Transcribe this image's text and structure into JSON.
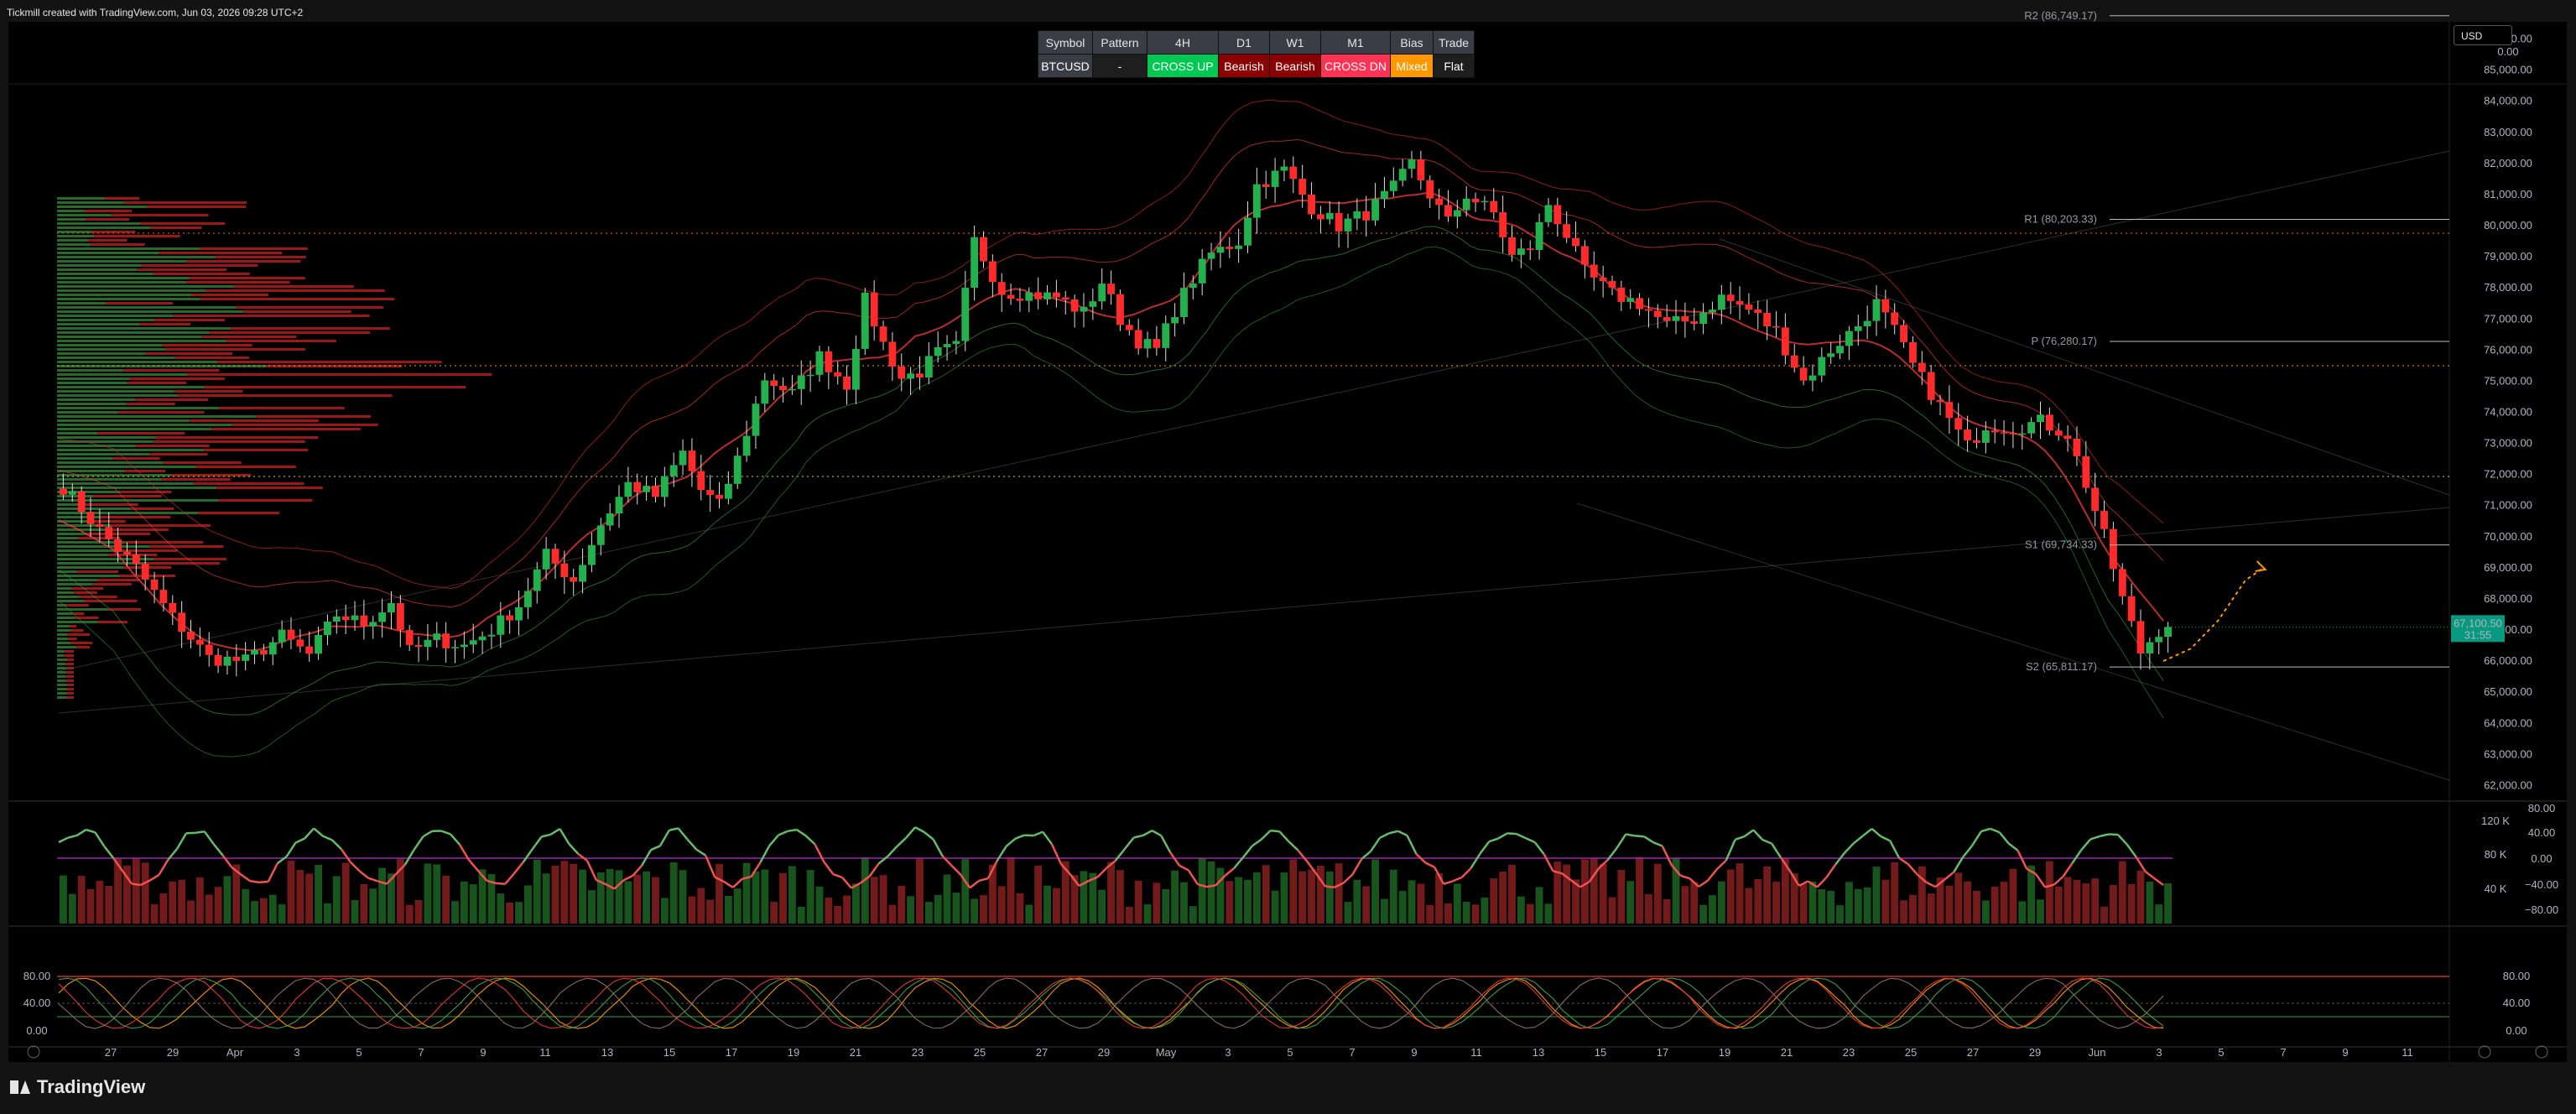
{
  "header": {
    "title": "Tickmill created with TradingView.com, Jun 03, 2026 09:28 UTC+2"
  },
  "currency_selector": {
    "value": "USD"
  },
  "brand": {
    "name": "TradingView"
  },
  "mtf_table": {
    "headers": [
      "Symbol",
      "Pattern",
      "4H",
      "D1",
      "W1",
      "M1",
      "Bias",
      "Trade"
    ],
    "values": [
      "BTCUSD",
      "-",
      "CROSS UP",
      "Bearish",
      "Bearish",
      "CROSS DN",
      "Mixed",
      "Flat"
    ],
    "value_colors": [
      "#3a3d45",
      "#1e1e1e",
      "#00c853",
      "#8b0000",
      "#8b0000",
      "#ff3355",
      "#ff9800",
      "#1e1e1e"
    ]
  },
  "chart_data": {
    "type": "candlestick",
    "symbol": "BTCUSD",
    "price_axis": {
      "ylim": [
        62000,
        86000
      ],
      "ticks": [
        "86,000.00",
        "85,000.00",
        "84,000.00",
        "83,000.00",
        "82,000.00",
        "81,000.00",
        "80,000.00",
        "79,000.00",
        "78,000.00",
        "77,000.00",
        "76,000.00",
        "75,000.00",
        "74,000.00",
        "73,000.00",
        "72,000.00",
        "71,000.00",
        "70,000.00",
        "69,000.00",
        "68,000.00",
        "67,000.00",
        "66,000.00",
        "65,000.00",
        "64,000.00",
        "63,000.00",
        "62,000.00"
      ],
      "top_label": "0.00"
    },
    "last_price": {
      "value": "67,100.50",
      "countdown": "31:55",
      "color": "#089981"
    },
    "pivots": [
      {
        "label": "R2 (86,749.17)",
        "value": 86749.17
      },
      {
        "label": "R1 (80,203.33)",
        "value": 80203.33
      },
      {
        "label": "P (76,280.17)",
        "value": 76280.17
      },
      {
        "label": "S1 (69,734.33)",
        "value": 69734.33
      },
      {
        "label": "S2 (65,811.17)",
        "value": 65811.17
      }
    ],
    "x_axis_ticks": [
      "27",
      "29",
      "Apr",
      "3",
      "5",
      "7",
      "9",
      "11",
      "13",
      "15",
      "17",
      "19",
      "21",
      "23",
      "25",
      "27",
      "29",
      "May",
      "3",
      "5",
      "7",
      "9",
      "11",
      "13",
      "15",
      "17",
      "19",
      "21",
      "23",
      "25",
      "27",
      "29",
      "Jun",
      "3",
      "5",
      "7",
      "9",
      "11"
    ],
    "close_path": [
      [
        0,
        71600
      ],
      [
        4,
        70200
      ],
      [
        8,
        69000
      ],
      [
        12,
        67400
      ],
      [
        16,
        66100
      ],
      [
        20,
        66000
      ],
      [
        24,
        66800
      ],
      [
        27,
        66200
      ],
      [
        30,
        67500
      ],
      [
        33,
        67200
      ],
      [
        36,
        67900
      ],
      [
        38,
        66300
      ],
      [
        41,
        66700
      ],
      [
        44,
        66500
      ],
      [
        47,
        67000
      ],
      [
        50,
        67800
      ],
      [
        53,
        69400
      ],
      [
        56,
        68600
      ],
      [
        59,
        70400
      ],
      [
        62,
        71700
      ],
      [
        65,
        71300
      ],
      [
        68,
        72700
      ],
      [
        70,
        71500
      ],
      [
        72,
        71000
      ],
      [
        74,
        72500
      ],
      [
        77,
        75100
      ],
      [
        80,
        74600
      ],
      [
        83,
        75800
      ],
      [
        86,
        74900
      ],
      [
        88,
        77600
      ],
      [
        90,
        76200
      ],
      [
        92,
        75100
      ],
      [
        94,
        75300
      ],
      [
        96,
        75900
      ],
      [
        98,
        76100
      ],
      [
        100,
        79500
      ],
      [
        103,
        77900
      ],
      [
        106,
        77800
      ],
      [
        109,
        77700
      ],
      [
        112,
        77200
      ],
      [
        114,
        78200
      ],
      [
        116,
        77000
      ],
      [
        118,
        76300
      ],
      [
        120,
        76000
      ],
      [
        122,
        77300
      ],
      [
        124,
        78300
      ],
      [
        126,
        79100
      ],
      [
        129,
        79500
      ],
      [
        131,
        81300
      ],
      [
        134,
        81800
      ],
      [
        137,
        80600
      ],
      [
        140,
        80000
      ],
      [
        143,
        80400
      ],
      [
        146,
        81200
      ],
      [
        148,
        82000
      ],
      [
        150,
        81000
      ],
      [
        152,
        80100
      ],
      [
        154,
        81000
      ],
      [
        157,
        80400
      ],
      [
        159,
        79000
      ],
      [
        161,
        79300
      ],
      [
        163,
        80700
      ],
      [
        165,
        79700
      ],
      [
        167,
        78500
      ],
      [
        170,
        77800
      ],
      [
        173,
        77500
      ],
      [
        176,
        76800
      ],
      [
        179,
        77000
      ],
      [
        182,
        77700
      ],
      [
        185,
        77300
      ],
      [
        188,
        76600
      ],
      [
        191,
        75000
      ],
      [
        194,
        76000
      ],
      [
        197,
        76800
      ],
      [
        199,
        77500
      ],
      [
        201,
        76600
      ],
      [
        203,
        75500
      ],
      [
        206,
        74200
      ],
      [
        209,
        72900
      ],
      [
        211,
        73600
      ],
      [
        214,
        73500
      ],
      [
        217,
        73700
      ],
      [
        220,
        73300
      ],
      [
        222,
        71700
      ],
      [
        224,
        70000
      ],
      [
        226,
        68000
      ],
      [
        228,
        66300
      ],
      [
        230,
        67000
      ],
      [
        231,
        67100
      ]
    ],
    "projection": [
      [
        231,
        66000
      ],
      [
        234,
        66400
      ],
      [
        237,
        67300
      ],
      [
        240,
        68600
      ],
      [
        242,
        69000
      ]
    ],
    "rsi_panel": {
      "ticks": [
        "80.00",
        "40.00",
        "0.00",
        "−40.00",
        "−80.00"
      ],
      "volume_ticks": [
        "120 K",
        "80 K",
        "40 K"
      ]
    },
    "stoch_panel": {
      "ticks": [
        "80.00",
        "40.00",
        "0.00"
      ],
      "levels": [
        80,
        40,
        0
      ]
    }
  }
}
